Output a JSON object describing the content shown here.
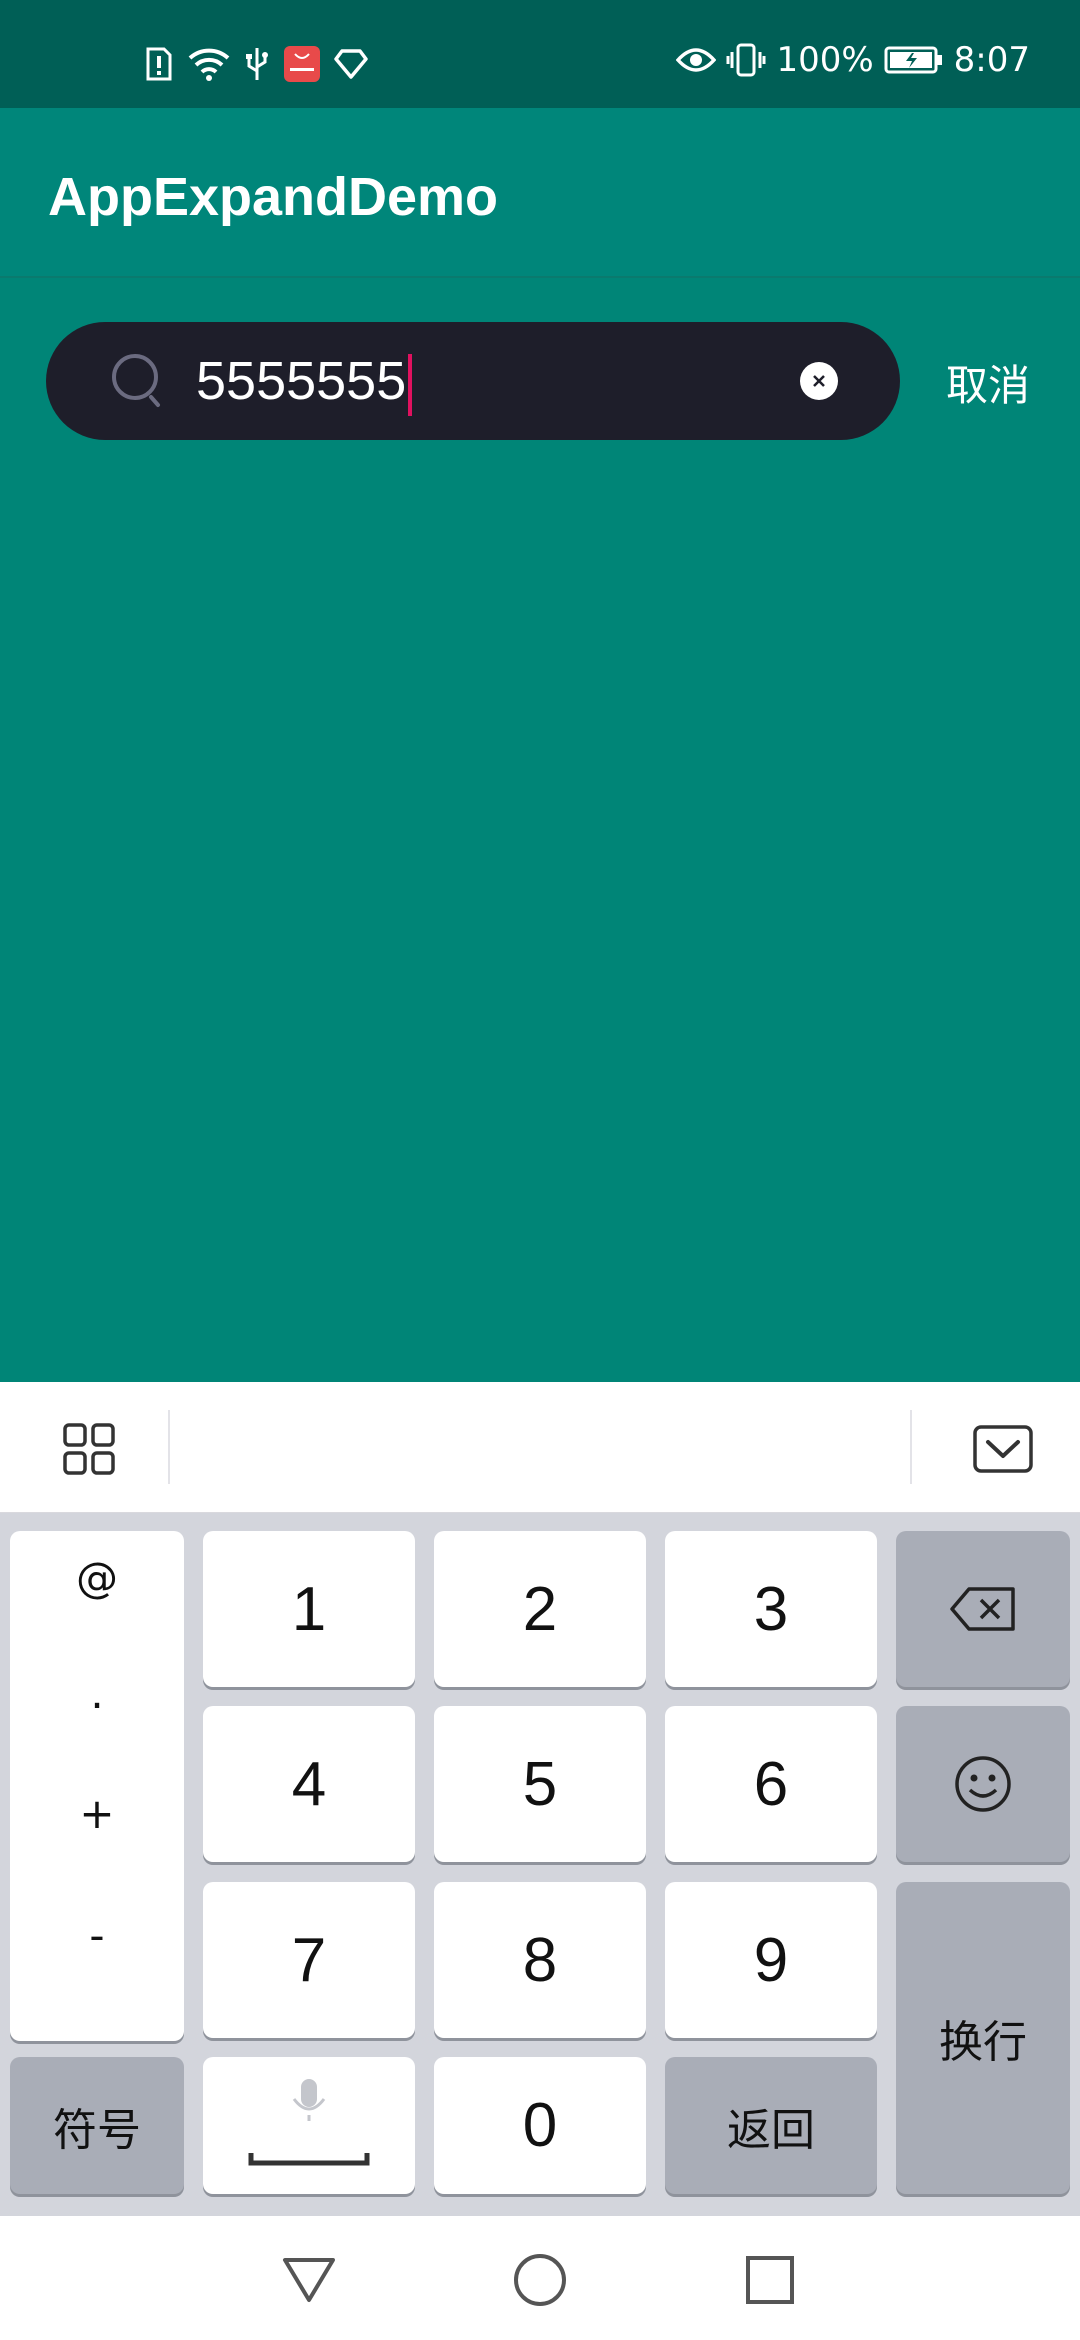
{
  "status_bar": {
    "battery_percent": "100%",
    "time": "8:07"
  },
  "app_bar": {
    "title": "AppExpandDemo"
  },
  "search": {
    "value": "5555555",
    "cancel_label": "取消"
  },
  "keyboard": {
    "symbols": [
      "@",
      ".",
      "+",
      "-"
    ],
    "digits": [
      "1",
      "2",
      "3",
      "4",
      "5",
      "6",
      "7",
      "8",
      "9",
      "0"
    ],
    "symbol_key_label": "符号",
    "return_key_label": "返回",
    "enter_key_label": "换行"
  },
  "colors": {
    "primary": "#008577",
    "primary_dark": "#005f56",
    "accent": "#e0115f",
    "search_bg": "#1e1e2a"
  },
  "icons": {
    "status_left": [
      "sim-alert-icon",
      "wifi-icon",
      "usb-icon",
      "huawei-app-icon",
      "diamond-icon"
    ],
    "status_right": [
      "eye-icon",
      "vibrate-icon",
      "battery-icon"
    ],
    "keyboard_toolbar": [
      "grid-menu-icon",
      "keyboard-hide-icon"
    ],
    "navigation": [
      "back-triangle-icon",
      "home-circle-icon",
      "recents-square-icon"
    ]
  }
}
